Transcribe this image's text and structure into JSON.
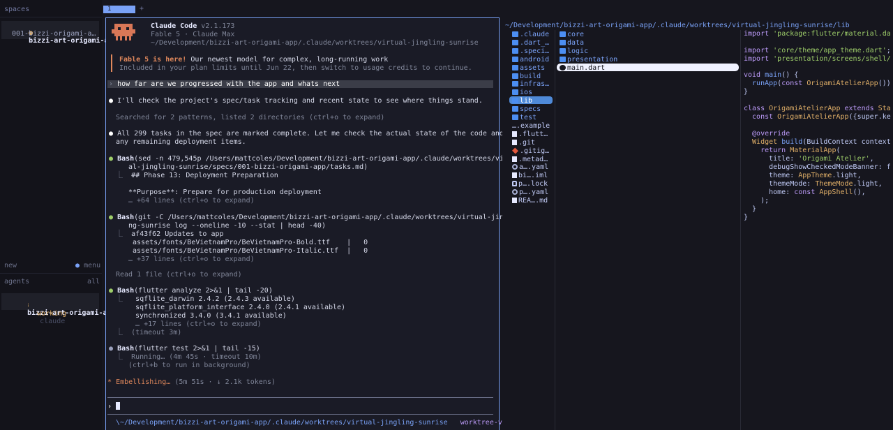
{
  "sidebar": {
    "spaces_label": "spaces",
    "space": {
      "name": "bizzi-art-origami-app",
      "sub": "001-bizzi-origami-a…"
    },
    "new_label": "new",
    "menu_label": "menu",
    "agents_label": "agents",
    "all_label": "all",
    "agent": {
      "name": "bizzi-art-origami-app",
      "status": "working",
      "kind": "claude"
    }
  },
  "tabs": {
    "active": "1",
    "add": "+"
  },
  "claude": {
    "app_name": "Claude Code",
    "version": "v2.1.173",
    "model_line": "Fable 5 · Claude Max",
    "cwd": "~/Development/bizzi-art-origami-app/.claude/worktrees/virtual-jingling-sunrise",
    "notice_bold": "Fable 5 is here!",
    "notice_rest": " Our newest model for complex, long-running work",
    "notice_sub": "Included in your plan limits until Jun 22, then switch to usage credits to continue.",
    "user_prompt": "how far are we progressed with the app and whats next",
    "msg1": "I'll check the project's spec/task tracking and recent state to see where things stand.",
    "searched": "Searched for 2 patterns, listed 2 directories (ctrl+o to expand)",
    "msg2a": "All 299 tasks in the spec are marked complete. Let me check the actual state of the code and",
    "msg2b": "any remaining deployment items.",
    "bash1a": "(sed -n 479,545p /Users/mattcoles/Development/bizzi-art-origami-app/.claude/worktrees/virtu",
    "bash1b": "al-jingling-sunrise/specs/001-bizzi-origami-app/tasks.md)",
    "bash1_out1": "## Phase 13: Deployment Preparation",
    "bash1_out2": "**Purpose**: Prepare for production deployment",
    "bash1_more": "… +64 lines (ctrl+o to expand)",
    "bash2a": "(git -C /Users/mattcoles/Development/bizzi-art-origami-app/.claude/worktrees/virtual-jingli",
    "bash2b": "ng-sunrise log --oneline -10 --stat | head -40)",
    "bash2_out1": "af43f62 Updates to app",
    "bash2_out2": " assets/fonts/BeVietnamPro/BeVietnamPro-Bold.ttf    |   0",
    "bash2_out3": " assets/fonts/BeVietnamPro/BeVietnamPro-Italic.ttf  |   0",
    "bash2_more": "… +37 lines (ctrl+o to expand)",
    "read_line": "Read 1 file (ctrl+o to expand)",
    "bash3": "(flutter analyze 2>&1 | tail -20)",
    "bash3_out1": "  sqflite_darwin 2.4.2 (2.4.3 available)",
    "bash3_out2": "  sqflite_platform_interface 2.4.0 (2.4.1 available)",
    "bash3_out3": "  synchronized 3.4.0 (3.4.1 available)",
    "bash3_more": "  … +17 lines (ctrl+o to expand)",
    "bash3_timeout": "(timeout 3m)",
    "bash4": "(flutter test 2>&1 | tail -15)",
    "bash4_out1": "Running… (4m 45s · timeout 10m)",
    "bash4_out2": "(ctrl+b to run in background)",
    "bash_label": "Bash",
    "status_word": "Embellishing…",
    "status_meta": " (5m 51s · ↓ 2.1k tokens)",
    "input_prompt": "›",
    "footer_path": "\\~/Development/bizzi-art-origami-app/.claude/worktrees/virtual-jingling-sunrise",
    "footer_branch": "worktree-v…"
  },
  "files": {
    "path": "~/Development/bizzi-art-origami-app/.claude/worktrees/virtual-jingling-sunrise/lib",
    "col1": [
      {
        "name": ".claude",
        "type": "folder"
      },
      {
        "name": ".dart_…",
        "type": "folder"
      },
      {
        "name": ".speci…",
        "type": "folder"
      },
      {
        "name": "android",
        "type": "folder"
      },
      {
        "name": "assets",
        "type": "folder"
      },
      {
        "name": "build",
        "type": "folder"
      },
      {
        "name": "infras…",
        "type": "folder"
      },
      {
        "name": "ios",
        "type": "folder"
      },
      {
        "name": "lib",
        "type": "folder"
      },
      {
        "name": "specs",
        "type": "folder"
      },
      {
        "name": "test",
        "type": "folder"
      },
      {
        "name": "….example",
        "type": "plain"
      },
      {
        "name": ".flutt…",
        "type": "doc"
      },
      {
        "name": ".git",
        "type": "doc"
      },
      {
        "name": ".gitig…",
        "type": "git"
      },
      {
        "name": ".metad…",
        "type": "doc"
      },
      {
        "name": "a….yaml",
        "type": "gear"
      },
      {
        "name": "bi….iml",
        "type": "doc"
      },
      {
        "name": "p….lock",
        "type": "lock"
      },
      {
        "name": "p….yaml",
        "type": "gear"
      },
      {
        "name": "REA….md",
        "type": "doc"
      }
    ],
    "col2": [
      {
        "name": "core",
        "type": "folder"
      },
      {
        "name": "data",
        "type": "folder"
      },
      {
        "name": "logic",
        "type": "folder"
      },
      {
        "name": "presentation",
        "type": "folder"
      },
      {
        "name": "main.dart",
        "type": "dart"
      }
    ]
  },
  "code": {
    "l1a": "import ",
    "l1b": "'package:flutter/material.da",
    "l2a": "import ",
    "l2b": "'core/theme/app_theme.dart'",
    "l3a": "import ",
    "l3b": "'presentation/screens/shell/",
    "l4a": "void ",
    "l4b": "main",
    "l4c": "() {",
    "l5a": "  runApp",
    "l5b": "(",
    "l5c": "const ",
    "l5d": "OrigamiAtelierApp",
    "l5e": "())",
    "l6": "}",
    "l7a": "class ",
    "l7b": "OrigamiAtelierApp ",
    "l7c": "extends ",
    "l7d": "Sta",
    "l8a": "  const ",
    "l8b": "OrigamiAtelierApp",
    "l8c": "({super.ke",
    "l9": "  @override",
    "l10a": "  Widget ",
    "l10b": "build",
    "l10c": "(BuildContext context",
    "l11a": "    return ",
    "l11b": "MaterialApp",
    "l11c": "(",
    "l12a": "      title: ",
    "l12b": "'Origami Atelier'",
    "l12c": ",",
    "l13": "      debugShowCheckedModeBanner: f",
    "l14a": "      theme: ",
    "l14b": "AppTheme",
    "l14c": ".light,",
    "l15a": "      themeMode: ",
    "l15b": "ThemeMode",
    "l15c": ".light,",
    "l16a": "      home: ",
    "l16b": "const ",
    "l16c": "AppShell",
    "l16d": "(),",
    "l17": "    );",
    "l18": "  }",
    "l19": "}"
  }
}
